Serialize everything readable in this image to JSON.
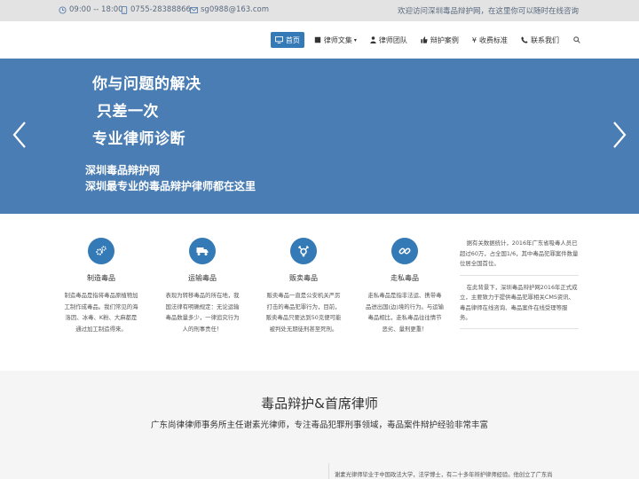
{
  "topbar": {
    "hours": "09:00 -- 18:00",
    "phone": "0755-28388866",
    "email": "sg0988@163.com",
    "welcome": "欢迎访问深圳毒品辩护网，在这里你可以随时在线咨询",
    "icons": [
      "clock-icon",
      "phone-icon",
      "mail-icon"
    ]
  },
  "nav": {
    "items": [
      {
        "label": "首页",
        "icon": "monitor-icon",
        "active": true
      },
      {
        "label": "律师文集",
        "icon": "book-icon",
        "dropdown": true
      },
      {
        "label": "律师团队",
        "icon": "person-icon"
      },
      {
        "label": "辩护案例",
        "icon": "thumbs-up-icon"
      },
      {
        "label": "收费标准",
        "icon": "yen-icon"
      },
      {
        "label": "联系我们",
        "icon": "phone-icon"
      }
    ],
    "search_icon": "search-icon",
    "accent": "#337ab7"
  },
  "hero": {
    "line1": "你与问题的解决",
    "line2": "只差一次",
    "line3": "专业律师诊断",
    "line4": "深圳毒品辩护网",
    "line5": "深圳最专业的毒品辩护律师都在这里",
    "background": "#4a7db3"
  },
  "services": [
    {
      "title": "制造毒品",
      "icon": "cogs-icon",
      "lines": [
        "制造毒品是指将毒品原植物加",
        "工制作成毒品。我们常见的海",
        "洛因、冰毒、K粉、大麻都是",
        "通过加工制造得来。"
      ]
    },
    {
      "title": "运输毒品",
      "icon": "truck-icon",
      "lines": [
        "表现为转移毒品的所在地，我",
        "国法律有明确规定：无论运输",
        "毒品数量多少，一律追究行为",
        "人的刑事责任！"
      ]
    },
    {
      "title": "贩卖毒品",
      "icon": "transgender-icon",
      "lines": [
        "贩卖毒品一直是公安机关严厉",
        "打击的毒品犯罪行为，目前，",
        "贩卖毒品只要达到50克便可能",
        "被判处无期徒刑甚至死刑。"
      ]
    },
    {
      "title": "走私毒品",
      "icon": "chain-icon",
      "lines": [
        "走私毒品是指非法运、携带毒",
        "品进出国(边)境的行为。与运输",
        "毒品相比，走私毒品往往情节",
        "恶劣、量刑更重！"
      ]
    }
  ],
  "side": {
    "p1": "据有关数据统计，2016年广东省吸毒人员已超过60万，占全国1/6，其中毒品犯罪案件数量位居全国首位。",
    "p2": "在此背景下，深圳毒品辩护网2016年正式成立，主要致力于提供毒品犯罪相关CMS资讯、毒品律师在线咨询、毒品案件在线受理等服务。"
  },
  "lawyer": {
    "heading": "毒品辩护&首席律师",
    "sub": "广东尚律律师事务所主任谢素光律师，专注毒品犯罪刑事领域，毒品案件辩护经验非常丰富",
    "bio": "谢素光律师毕业于中国政法大学，法学博士，有二十多年辩护律师经验。他创立了广东尚"
  }
}
